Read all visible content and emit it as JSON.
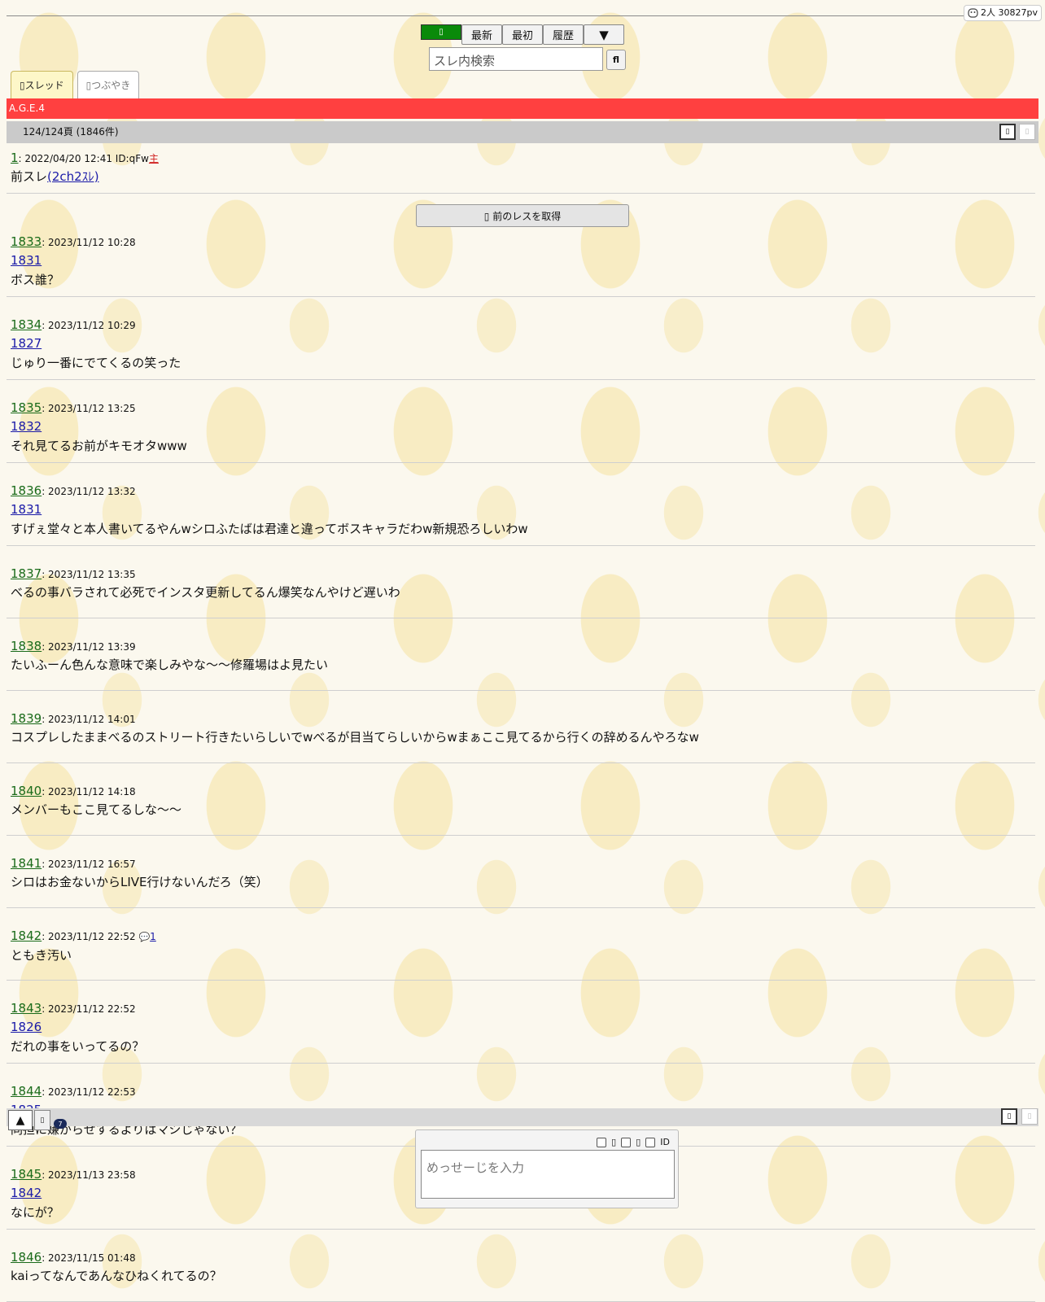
{
  "header": {
    "pv_text": "2人 30827pv",
    "nav": {
      "latest": "最新",
      "first": "最初",
      "history": "履歴",
      "more": "▼"
    },
    "search_placeholder": "スレ内検索",
    "search_button": "fl"
  },
  "tabs": [
    {
      "label": "▯スレッド"
    },
    {
      "label": "▯つぶやき"
    }
  ],
  "thread_title": "A.G.E.4",
  "pager": {
    "text": "124/124頁 (1846件)"
  },
  "first_post": {
    "num": "1",
    "meta": ": 2022/04/20 12:41 ID:qFw",
    "owner": "主",
    "body_prefix": "前スレ",
    "body_link": "(2ch2ｽﾚ)"
  },
  "prev_button": "▯ 前のレスを取得",
  "posts": [
    {
      "num": "1833",
      "date": ": 2023/11/12 10:28",
      "ref": "1831",
      "body": "ボス誰？"
    },
    {
      "num": "1834",
      "date": ": 2023/11/12 10:29",
      "ref": "1827",
      "body": "じゅり一番にでてくるの笑った"
    },
    {
      "num": "1835",
      "date": ": 2023/11/12 13:25",
      "ref": "1832",
      "body": "それ見てるお前がキモオタwww"
    },
    {
      "num": "1836",
      "date": ": 2023/11/12 13:32",
      "ref": "1831",
      "body": "すげぇ堂々と本人書いてるやんwシロふたばは君達と違ってボスキャラだわw新規恐ろしいわw"
    },
    {
      "num": "1837",
      "date": ": 2023/11/12 13:35",
      "ref": "",
      "body": "べるの事バラされて必死でインスタ更新してるん爆笑なんやけど遅いわ"
    },
    {
      "num": "1838",
      "date": ": 2023/11/12 13:39",
      "ref": "",
      "body": "たいふーん色んな意味で楽しみやな〜〜修羅場はよ見たい"
    },
    {
      "num": "1839",
      "date": ": 2023/11/12 14:01",
      "ref": "",
      "body": "コスプレしたままべるのストリート行きたいらしいでwべるが目当てらしいからwまぁここ見てるから行くの辞めるんやろなw"
    },
    {
      "num": "1840",
      "date": ": 2023/11/12 14:18",
      "ref": "",
      "body": "メンバーもここ見てるしな〜〜"
    },
    {
      "num": "1841",
      "date": ": 2023/11/12 16:57",
      "ref": "",
      "body": "シロはお金ないからLIVE行けないんだろ（笑）"
    },
    {
      "num": "1842",
      "date": ": 2023/11/12 22:52",
      "ref": "",
      "body": "ともき汚い",
      "reply_count": "1"
    },
    {
      "num": "1843",
      "date": ": 2023/11/12 22:52",
      "ref": "1826",
      "body": "だれの事をいってるの？"
    },
    {
      "num": "1844",
      "date": ": 2023/11/12 22:53",
      "ref": "1825",
      "body": "同担に嫌がらせするよりはマシじゃない？"
    },
    {
      "num": "1845",
      "date": ": 2023/11/13 23:58",
      "ref": "1842",
      "body": "なにが？"
    },
    {
      "num": "1846",
      "date": ": 2023/11/15 01:48",
      "ref": "",
      "body": "kaiってなんであんなひねくれてるの？"
    }
  ],
  "footer": {
    "up": "▲",
    "small": "▯",
    "badge": "7",
    "opt1": "▯",
    "opt2": "▯",
    "opt3": "ID",
    "message_placeholder": "めっせーじを入力"
  },
  "icons": {
    "pv": "face-icon",
    "reply": "speech-bubble-icon"
  }
}
